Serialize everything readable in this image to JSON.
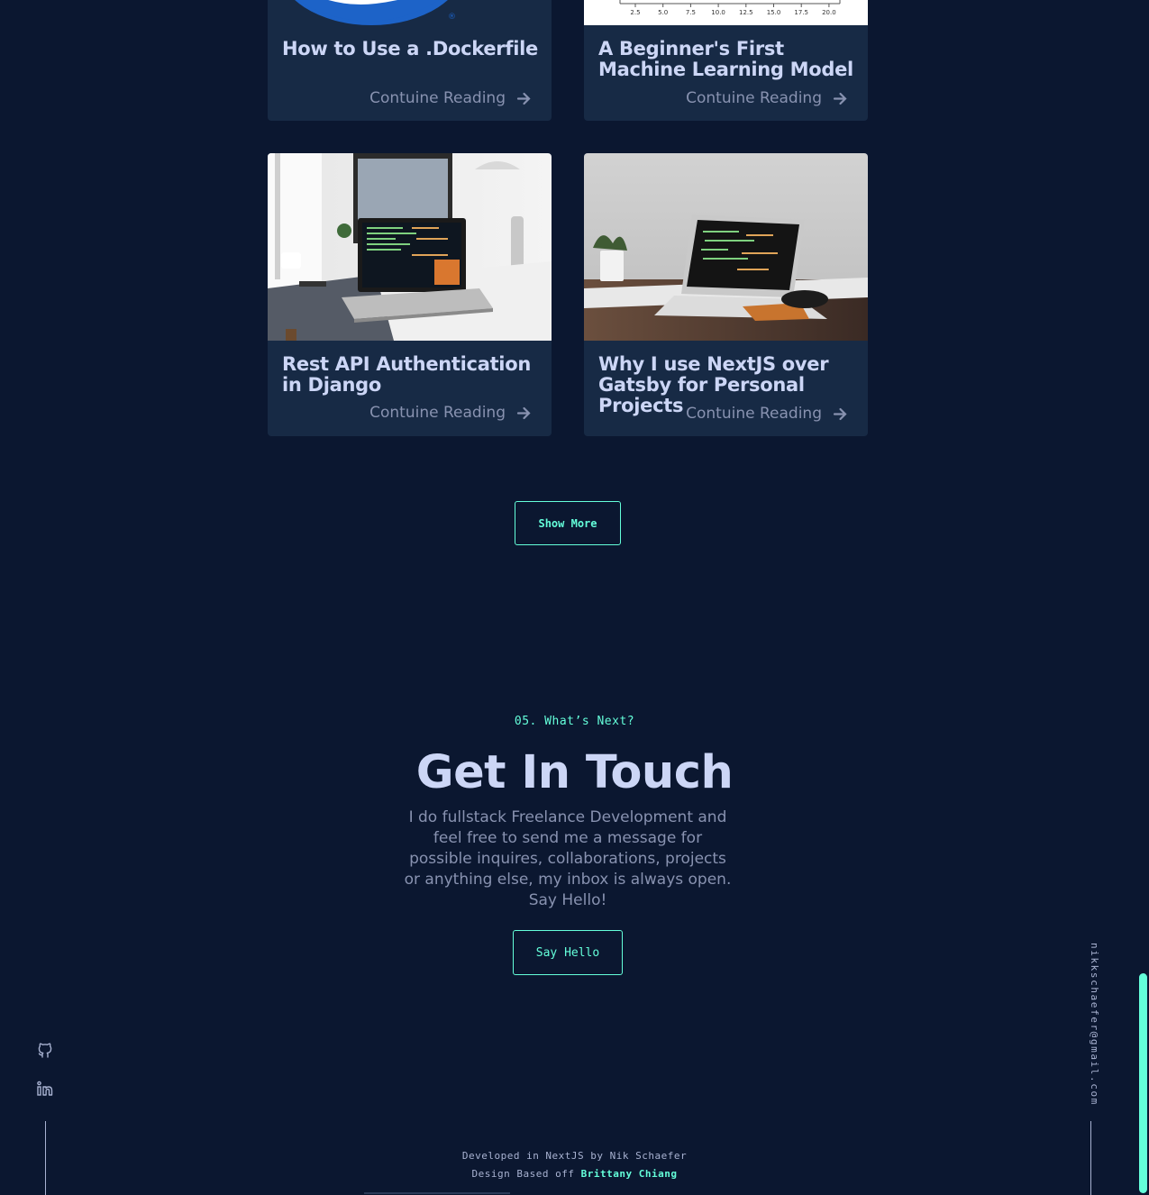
{
  "cards": [
    {
      "title": "How to Use a .Dockerfile",
      "read_more": "Contuine Reading",
      "image": "docker-logo"
    },
    {
      "title": "A Beginner's First Machine Learning Model",
      "read_more": "Contuine Reading",
      "image": "plot-axis"
    },
    {
      "title": "Rest API Authentication in Django",
      "read_more": "Contuine Reading",
      "image": "laptop-desk-photo"
    },
    {
      "title": "Why I use NextJS over Gatsby for Personal Projects",
      "read_more": "Contuine Reading",
      "image": "laptop-photo"
    }
  ],
  "plot_ticks": [
    "2.5",
    "5.0",
    "7.5",
    "10.0",
    "12.5",
    "15.0",
    "17.5",
    "20.0"
  ],
  "show_more": "Show More",
  "contact": {
    "overline": "05. What’s Next?",
    "title": "Get In Touch",
    "body": "I do fullstack Freelance Development and feel free to send me a message for possible inquires, collaborations, projects or anything else, my inbox is always open. Say Hello!",
    "button": "Say Hello"
  },
  "email": "nikkschaefer@gmail.com",
  "social": [
    "github-icon",
    "linkedin-icon"
  ],
  "footer": {
    "line1": "Developed in NextJS by Nik Schaefer",
    "line2_prefix": "Design Based off",
    "line2_link": "Brittany Chiang"
  },
  "colors": {
    "background": "#0b1730",
    "card": "#172a45",
    "accent": "#64ffda",
    "heading": "#ccd6f6",
    "text": "#8892b0"
  }
}
